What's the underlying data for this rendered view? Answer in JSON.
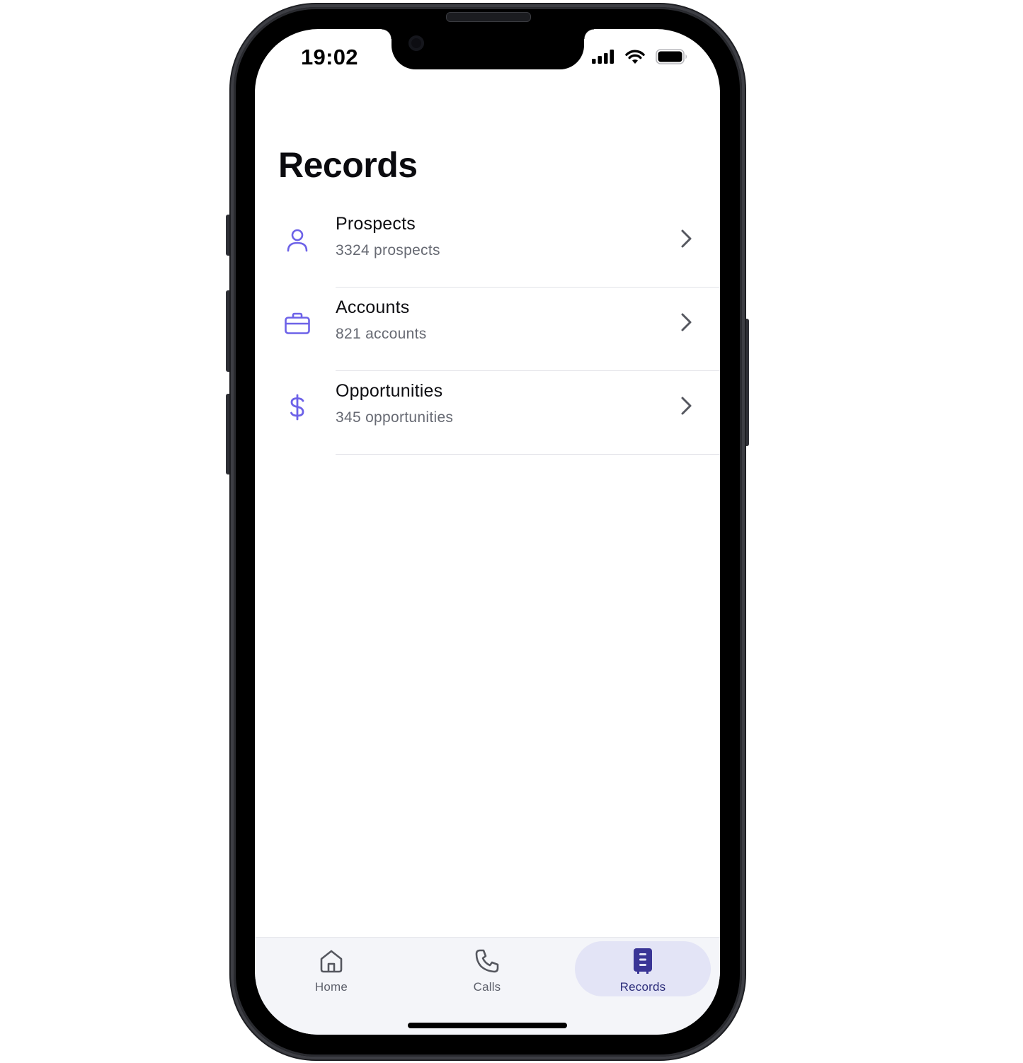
{
  "status_bar": {
    "time": "19:02"
  },
  "page": {
    "title": "Records"
  },
  "records": [
    {
      "title": "Prospects",
      "subtitle": "3324 prospects",
      "icon": "user-icon"
    },
    {
      "title": "Accounts",
      "subtitle": "821 accounts",
      "icon": "briefcase-icon"
    },
    {
      "title": "Opportunities",
      "subtitle": "345 opportunities",
      "icon": "dollar-icon"
    }
  ],
  "tab_bar": {
    "home": {
      "label": "Home",
      "icon": "home-icon"
    },
    "calls": {
      "label": "Calls",
      "icon": "phone-icon"
    },
    "records": {
      "label": "Records",
      "icon": "records-icon",
      "selected": true
    }
  },
  "colors": {
    "accent": "#6d62e8",
    "tab_active_bg": "#e3e4f6",
    "tab_active_text": "#2c2d7a",
    "text_primary": "#0e0e12",
    "text_secondary": "#676a73"
  }
}
